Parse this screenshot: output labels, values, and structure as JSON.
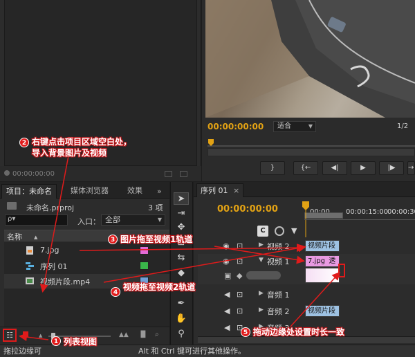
{
  "source_panel": {
    "timecode": "00:00:00:00"
  },
  "program_monitor": {
    "timecode": "00:00:00:00",
    "fit_label": "适合",
    "resolution": "1/2",
    "buttons": [
      "}",
      "{←",
      "◀|",
      "▶",
      "|▶",
      "→}"
    ]
  },
  "project_panel": {
    "tabs": [
      "项目：未命名",
      "媒体浏览器",
      "效果"
    ],
    "tab_more": "»",
    "file_name": "未命名.prproj",
    "item_count": "3 项",
    "search_placeholder": "ρ▾",
    "entry_label": "入口：",
    "entry_value": "全部",
    "column_name": "名称",
    "items": [
      {
        "name": "7.jpg",
        "type": "image",
        "color": "#e46ad6"
      },
      {
        "name": "序列 01",
        "type": "sequence",
        "color": "#3ab64a"
      },
      {
        "name": "视频片段.mp4",
        "type": "video",
        "color": "#6fa0d8"
      }
    ]
  },
  "timeline": {
    "tab": "序列 01",
    "tab_close": "×",
    "timecode": "00:00:00:00",
    "ruler_labels": [
      "00:00",
      "00:00:15:00",
      "00:00:30:0"
    ],
    "tracks": [
      {
        "name": "视频 2",
        "clip": "视频片段",
        "clip_type": "video"
      },
      {
        "name": "视频 1",
        "clip": "7.jpg",
        "clip_type": "image",
        "clip_suffix": "透▾"
      },
      {
        "name": "音频 1",
        "clip": "",
        "clip_type": "none"
      },
      {
        "name": "音频 2",
        "clip": "视频片段",
        "clip_type": "video"
      },
      {
        "name": "音频 3",
        "clip": "",
        "clip_type": "none"
      }
    ]
  },
  "status_bar": {
    "text_left": "拖拉边缘可",
    "text_right": "Alt 和 Ctrl 键可进行其他操作。"
  },
  "annotations": [
    {
      "num": "1",
      "text": "列表视图"
    },
    {
      "num": "2",
      "text": "右键点击项目区域空白处，",
      "text2": "导入背景图片及视频"
    },
    {
      "num": "3",
      "text": "图片拖至视频1轨道"
    },
    {
      "num": "4",
      "text": "视频拖至视频2轨道"
    },
    {
      "num": "5",
      "text": "拖动边缘处设置时长一致"
    }
  ],
  "colors": {
    "timecode": "#e2a214",
    "annotation": "#e01b1b",
    "clip_video": "#9ec2e3",
    "clip_image": "#e89ae2"
  }
}
